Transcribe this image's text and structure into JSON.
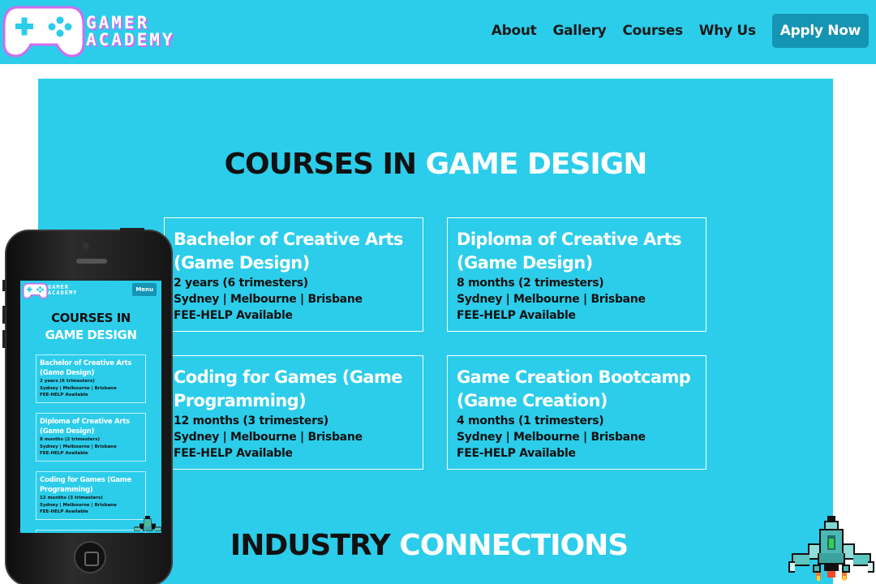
{
  "header": {
    "logo_line1": "GAMER",
    "logo_line2": "ACADEMY",
    "nav": [
      "About",
      "Gallery",
      "Courses",
      "Why Us"
    ],
    "cta": "Apply Now"
  },
  "courses_section": {
    "title_dark": "COURSES IN",
    "title_light": "GAME DESIGN",
    "courses": [
      {
        "title": "Bachelor of Creative Arts (Game Design)",
        "duration": "2 years (6 trimesters)",
        "locations": "Sydney | Melbourne | Brisbane",
        "funding": "FEE-HELP Available"
      },
      {
        "title": "Diploma of Creative Arts (Game Design)",
        "duration": "8 months (2 trimesters)",
        "locations": "Sydney | Melbourne | Brisbane",
        "funding": "FEE-HELP Available"
      },
      {
        "title": "Coding for Games (Game Programming)",
        "duration": "12 months (3 trimesters)",
        "locations": "Sydney | Melbourne | Brisbane",
        "funding": "FEE-HELP Available"
      },
      {
        "title": "Game Creation Bootcamp (Game Creation)",
        "duration": "4 months (1 trimesters)",
        "locations": "Sydney | Melbourne | Brisbane",
        "funding": "FEE-HELP Available"
      }
    ]
  },
  "industry_section": {
    "title_dark": "INDUSTRY",
    "title_light": "CONNECTIONS"
  },
  "mobile": {
    "logo_line1": "GAMER",
    "logo_line2": "ACADEMY",
    "menu": "Menu",
    "title_dark": "COURSES IN",
    "title_light": "GAME DESIGN"
  },
  "colors": {
    "brand_cyan": "#2bcdea",
    "button_blue": "#1594b3",
    "logo_shadow": "#d26bf0"
  },
  "icons": [
    "gamepad-logo-icon",
    "pixel-spaceship-icon"
  ]
}
